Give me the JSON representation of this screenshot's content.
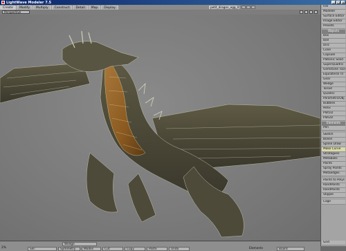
{
  "window": {
    "title": "LightWave Modeler 7.5",
    "min": "_",
    "max": "□",
    "close": "x"
  },
  "tabs": [
    {
      "label": "Create"
    },
    {
      "label": "Modify"
    },
    {
      "label": "Multiply"
    },
    {
      "label": "Construct"
    },
    {
      "label": "Detail"
    },
    {
      "label": "Map"
    },
    {
      "label": "Display"
    }
  ],
  "layer_name": "petit_dragon_egg_010...",
  "viewport": {
    "mode": "Perspective"
  },
  "sidebar": {
    "top": [
      "File",
      "Modeler",
      "Surface Editor",
      "Image Editor",
      "Presets"
    ],
    "objects_header": "Objects",
    "objects": [
      "Box",
      "Ball",
      "Disc",
      "Cone",
      "Capsule",
      "Platonic Solid",
      "SuperQuadric",
      "Gemstone Tool",
      "Equilateral Tri",
      "Gear",
      "Wedge",
      "Toroid",
      "Quadric",
      "ParametricObj",
      "Bubbles",
      "Helix",
      "Plot1D",
      "Plot2D"
    ],
    "elements_header": "Elements",
    "elements": [
      "Pen",
      "",
      "Sketch",
      "Bones",
      "Spline Draw",
      "Make Curve",
      "Stratagons",
      "Metaballs",
      "Points",
      "Spray Points",
      "Metaedges",
      "",
      "Points to Polys",
      "RandPoints",
      "RandPoints",
      "Stipple",
      "",
      "Cage"
    ],
    "bottom": [
      "Grid"
    ]
  },
  "bottom": {
    "row1": [
      "Wedge"
    ],
    "row2_labels": [
      "Sel:",
      "Symmetry",
      "Modes",
      "Cut",
      "Copy",
      "Paste",
      "Undo"
    ],
    "right": {
      "label": "Elements",
      "value": "Board"
    },
    "percent": "2%"
  },
  "colors": {
    "title_start": "#0a246a",
    "viewport_bg": "#7a7a7a",
    "sidebar_bg": "#a4a4a4",
    "highlight": "#d9d9a9"
  }
}
